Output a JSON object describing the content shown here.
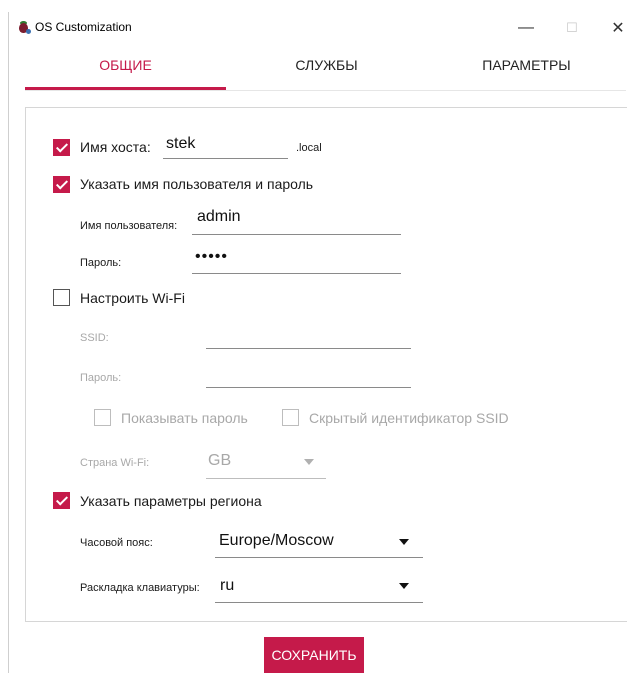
{
  "window": {
    "title": "OS Customization",
    "minimize": "—",
    "maximize": "☐",
    "close": "✕"
  },
  "tabs": [
    {
      "label": "ОБЩИЕ",
      "active": true
    },
    {
      "label": "СЛУЖБЫ",
      "active": false
    },
    {
      "label": "ПАРАМЕТРЫ",
      "active": false
    }
  ],
  "hostname": {
    "checked": true,
    "label": "Имя хоста:",
    "value": "stek",
    "suffix": ".local"
  },
  "user": {
    "checked": true,
    "label": "Указать имя пользователя и пароль",
    "username_label": "Имя пользователя:",
    "username_value": "admin",
    "password_label": "Пароль:",
    "password_value": "•••••"
  },
  "wifi": {
    "checked": false,
    "label": "Настроить Wi-Fi",
    "ssid_label": "SSID:",
    "ssid_value": "",
    "password_label": "Пароль:",
    "password_value": "",
    "show_password_label": "Показывать пароль",
    "hidden_ssid_label": "Скрытый идентификатор SSID",
    "country_label": "Страна Wi-Fi:",
    "country_value": "GB"
  },
  "locale": {
    "checked": true,
    "label": "Указать параметры региона",
    "timezone_label": "Часовой пояс:",
    "timezone_value": "Europe/Moscow",
    "keyboard_label": "Раскладка клавиатуры:",
    "keyboard_value": "ru"
  },
  "actions": {
    "save_label": "СОХРАНИТЬ"
  },
  "colors": {
    "accent": "#c51a4a"
  }
}
